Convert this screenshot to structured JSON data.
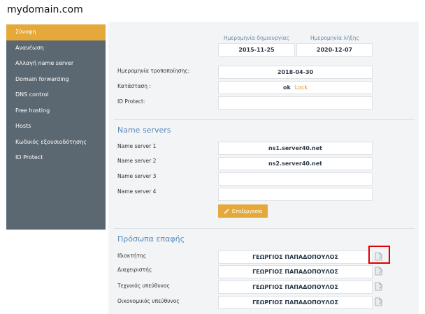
{
  "domain": "mydomain.com",
  "sidebar": {
    "items": [
      {
        "label": "Σύνοψη",
        "active": true
      },
      {
        "label": "Ανανέωση",
        "active": false
      },
      {
        "label": "Αλλαγή name server",
        "active": false
      },
      {
        "label": "Domain forwarding",
        "active": false
      },
      {
        "label": "DNS control",
        "active": false
      },
      {
        "label": "Free hosting",
        "active": false
      },
      {
        "label": "Hosts",
        "active": false
      },
      {
        "label": "Κωδικός εξουσιοδότησης",
        "active": false
      },
      {
        "label": "ID Protect",
        "active": false
      }
    ],
    "active_color": "#e4a93a",
    "background": "#5b6771"
  },
  "summary": {
    "created_header": "Ημερομηνία δημιουργίας",
    "expires_header": "Ημερομηνία λήξης",
    "created_value": "2015-11-25",
    "expires_value": "2020-12-07",
    "modified_label": "Ημερομηνία τροποποίησης:",
    "modified_value": "2018-04-30",
    "status_label": "Κατάσταση :",
    "status_value": "ok",
    "lock_link": "Lock",
    "id_protect_label": "ID Protect:",
    "id_protect_value": ""
  },
  "name_servers": {
    "title": "Name servers",
    "rows": [
      {
        "label": "Name server 1",
        "value": "ns1.server40.net"
      },
      {
        "label": "Name server 2",
        "value": "ns2.server40.net"
      },
      {
        "label": "Name server 3",
        "value": ""
      },
      {
        "label": "Name server 4",
        "value": ""
      }
    ],
    "edit_button": "Επεξεργασία"
  },
  "contacts": {
    "title": "Πρόσωπα επαφής",
    "rows": [
      {
        "label": "Ιδιοκτήτης",
        "value": "ΓΕΩΡΓΙΟΣ ΠΑΠΑΔΟΠΟΥΛΟΣ",
        "highlighted": true
      },
      {
        "label": "Διαχειριστής",
        "value": "ΓΕΩΡΓΙΟΣ ΠΑΠΑΔΟΠΟΥΛΟΣ",
        "highlighted": false
      },
      {
        "label": "Τεχνικός υπεύθυνος",
        "value": "ΓΕΩΡΓΙΟΣ ΠΑΠΑΔΟΠΟΥΛΟΣ",
        "highlighted": false
      },
      {
        "label": "Οικονομικός υπεύθυνος",
        "value": "ΓΕΩΡΓΙΟΣ ΠΑΠΑΔΟΠΟΥΛΟΣ",
        "highlighted": false
      }
    ],
    "icon": "edit-document-icon",
    "highlight_color": "#e00000"
  }
}
